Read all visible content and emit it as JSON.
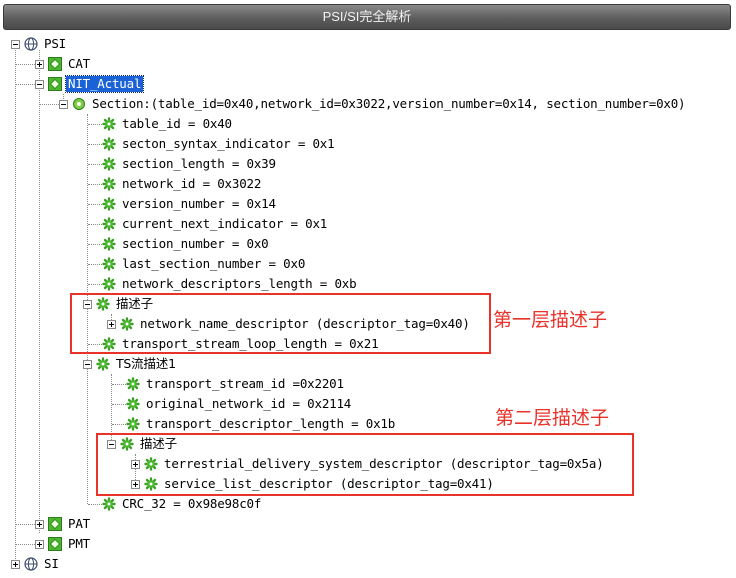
{
  "window": {
    "title": "PSI/SI完全解析"
  },
  "tree": {
    "psi": "PSI",
    "cat": "CAT",
    "nit": "NIT_Actual",
    "section": "Section:(table_id=0x40,network_id=0x3022,version_number=0x14, section_number=0x0)",
    "fields": [
      "table_id = 0x40",
      "secton_syntax_indicator = 0x1",
      "section_length = 0x39",
      "network_id = 0x3022",
      "version_number = 0x14",
      "current_next_indicator = 0x1",
      "section_number = 0x0",
      "last_section_number = 0x0",
      "network_descriptors_length = 0xb"
    ],
    "descriptor_group_1": "描述子",
    "network_name_descriptor": "network_name_descriptor (descriptor_tag=0x40)",
    "transport_stream_loop_length": "transport_stream_loop_length = 0x21",
    "ts_loop": "TS流描述1",
    "ts_fields": [
      "transport_stream_id =0x2201",
      "original_network_id = 0x2114",
      "transport_descriptor_length = 0x1b"
    ],
    "descriptor_group_2": "描述子",
    "terrestrial_descriptor": "terrestrial_delivery_system_descriptor (descriptor_tag=0x5a)",
    "service_list_descriptor": "service_list_descriptor (descriptor_tag=0x41)",
    "crc": "CRC_32 = 0x98e98c0f",
    "pat": "PAT",
    "pmt": "PMT",
    "si": "SI"
  },
  "annotations": {
    "layer1": "第一层描述子",
    "layer2": "第二层描述子"
  },
  "colors": {
    "selection": "#1a62d6",
    "annotation": "#e8322a",
    "table_icon": "#49b82e",
    "field_icon": "#3f9e2a"
  },
  "icons": {
    "root": "globe-icon",
    "table": "table-icon",
    "field": "gear-icon"
  }
}
